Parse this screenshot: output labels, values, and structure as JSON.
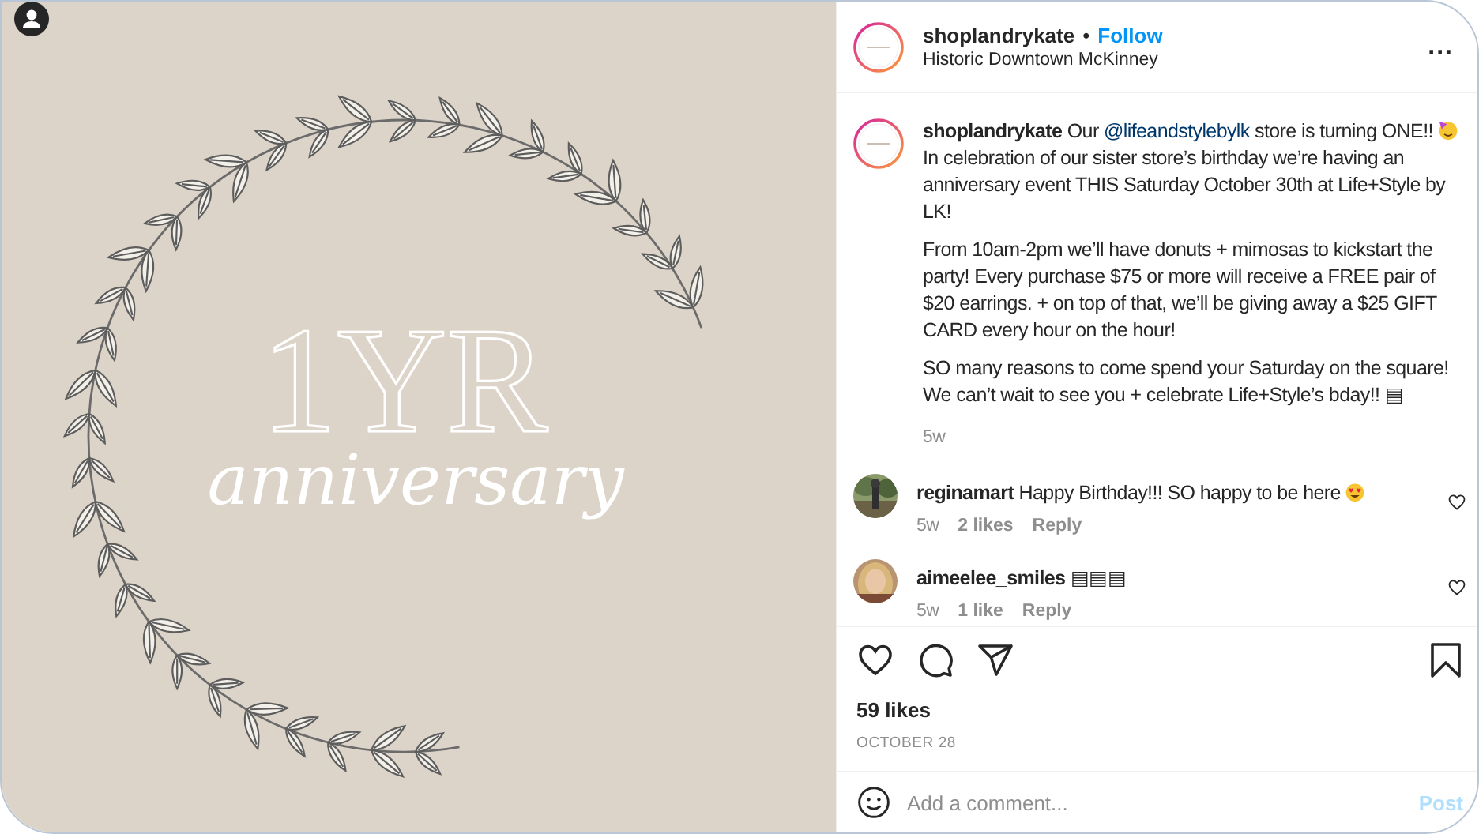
{
  "post_image": {
    "title": "1YR",
    "subtitle": "anniversary"
  },
  "header": {
    "username": "shoplandrykate",
    "separator": "•",
    "follow": "Follow",
    "location": "Historic Downtown McKinney",
    "more": "..."
  },
  "caption": {
    "username": "shoplandrykate",
    "before_mention": "Our",
    "mention": "@lifeandstylebylk",
    "after_mention": "store is turning ONE!!",
    "rest": "In celebration of our sister store’s birthday we’re having an anniversary event THIS Saturday October 30th at Life+Style by LK!",
    "paragraphs": [
      "From 10am-2pm we’ll have donuts + mimosas to kickstart the party! Every purchase $75 or more will receive a FREE pair of $20 earrings. + on top of that, we’ll be giving away a $25 GIFT CARD every hour on the hour!",
      "SO many reasons to come spend your Saturday on the square! We can’t wait to see you + celebrate Life+Style’s bday!! ▤"
    ],
    "age": "5w"
  },
  "comments": [
    {
      "username": "reginamart",
      "text": "Happy Birthday!!! SO happy to be here",
      "emoji": true,
      "age": "5w",
      "likes": "2 likes",
      "reply": "Reply"
    },
    {
      "username": "aimeelee_smiles",
      "text": "▤▤▤",
      "emoji": false,
      "age": "5w",
      "likes": "1 like",
      "reply": "Reply"
    }
  ],
  "likes": "59 likes",
  "date": "OCTOBER 28",
  "add_comment": {
    "placeholder": "Add a comment...",
    "post": "Post"
  }
}
